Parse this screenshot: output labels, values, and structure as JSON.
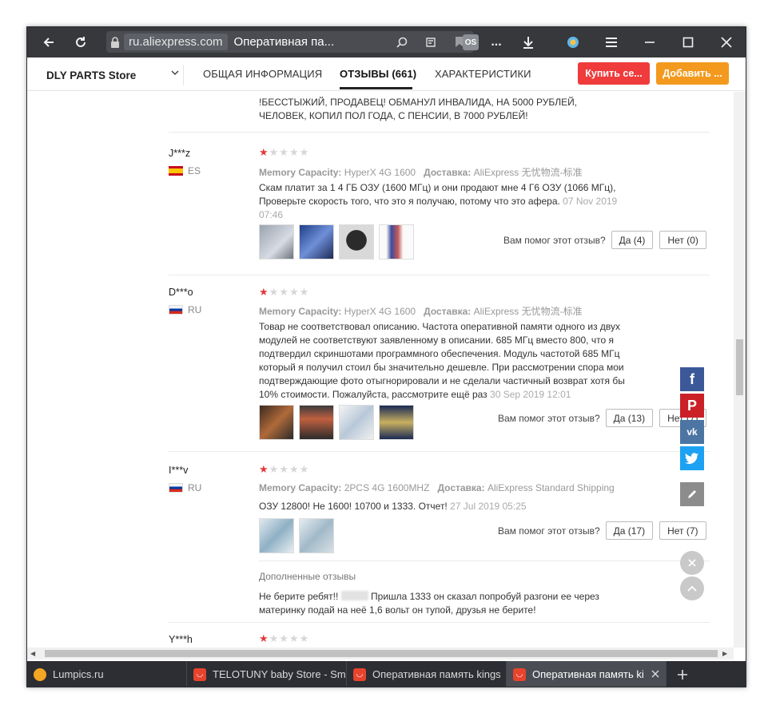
{
  "browser": {
    "domain": "ru.aliexpress.com",
    "page_title": "Оперативная па...",
    "ext_label": "OS",
    "more": "..."
  },
  "header": {
    "store_name": "DLY PARTS Store",
    "tabs": [
      "ОБЩАЯ ИНФОРМАЦИЯ",
      "ОТЗЫВЫ (661)",
      "ХАРАКТЕРИСТИКИ"
    ],
    "buy_label": "Купить се...",
    "add_label": "Добавить ..."
  },
  "reviews": {
    "top_text": "!БЕССТЫЖИЙ, ПРОДАВЕЦ! ОБМАНУЛ ИНВАЛИДА, НА 5000 РУБЛЕЙ, ЧЕЛОВЕК, КОПИЛ ПОЛ ГОДА, С ПЕНСИИ, В 7000 РУБЛЕЙ!",
    "capacity_label": "Memory Capacity:",
    "delivery_label": "Доставка:",
    "helpful_q": "Вам помог этот отзыв?",
    "items": [
      {
        "user": "J***z",
        "country": "ES",
        "rating": 1,
        "capacity": "HyperX 4G 1600",
        "delivery": "AliExpress 无忧物流-标准",
        "text": "Скам платит за 1 4 ГБ ОЗУ (1600 МГц) и они продают мне 4 Г6 ОЗУ (1066 МГц), Проверьте скорость того, что это я получаю, потому что это афера.",
        "date": "07 Nov 2019 07:46",
        "yes": "Да (4)",
        "no": "Нет (0)"
      },
      {
        "user": "D***o",
        "country": "RU",
        "rating": 1,
        "capacity": "HyperX 4G 1600",
        "delivery": "AliExpress 无忧物流-标准",
        "text": "Товар не соответствовал описанию. Частота оперативной памяти одного из двух модулей не соответствуют заявленному в описании. 685 МГц вместо 800, что я подтвердил скриншотами программного обеспечения. Модуль частотой 685 МГц который я получил стоил бы значительно дешевле. При рассмотрении спора мои подтверждающие фото отыгнорировали и не сделали частичный возврат хотя бы 10% стоимости. Пожалуйста, рассмотрите ещё раз",
        "date": "30 Sep 2019 12:01",
        "yes": "Да (13)",
        "no": "Нет (7)"
      },
      {
        "user": "I***v",
        "country": "RU",
        "rating": 1,
        "capacity": "2PCS 4G 1600MHZ",
        "delivery": "AliExpress Standard Shipping",
        "text": "ОЗУ 12800! Не 1600! 10700 и 1333. Отчет!",
        "date": "27 Jul 2019 05:25",
        "yes": "Да (17)",
        "no": "Нет (7)",
        "additional_title": "Дополненные отзывы",
        "additional_text_a": "Не берите ребят!!",
        "additional_text_b": "Пришла 1333 он сказал попробуй разгони ее через материнку подай на неё 1,6 вольт он тупой, друзья не берите!"
      },
      {
        "user": "Y***h",
        "rating": 1
      }
    ]
  },
  "tabs_bar": [
    {
      "title": "Lumpics.ru"
    },
    {
      "title": "TELOTUNY baby Store - Sm"
    },
    {
      "title": "Оперативная память kings"
    },
    {
      "title": "Оперативная память kir"
    }
  ],
  "share": [
    "facebook-icon",
    "pinterest-icon",
    "vk-icon",
    "twitter-icon",
    "edit-icon"
  ],
  "colors": {
    "accent": "#ef3b3b",
    "add": "#f39a1e",
    "star": "#e4393c",
    "facebook": "#3b5998",
    "pinterest": "#cb2027",
    "vk": "#4c75a3",
    "twitter": "#1da1f2"
  }
}
